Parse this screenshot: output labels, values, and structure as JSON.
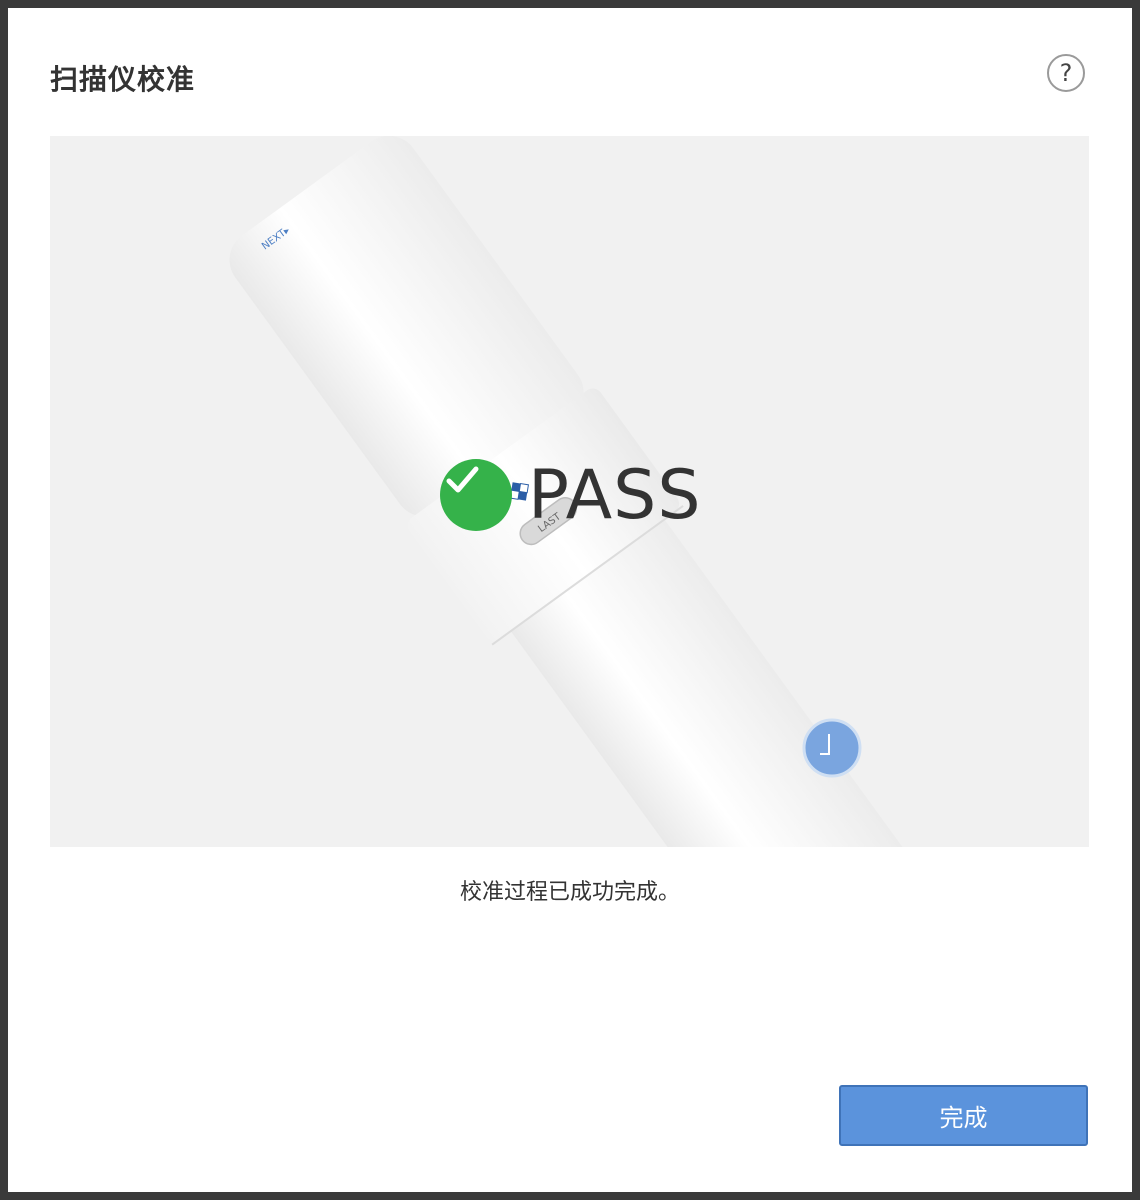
{
  "dialog": {
    "title": "扫描仪校准",
    "help_symbol": "?"
  },
  "illustration": {
    "button_next_label": "NEXT▸",
    "button_last_label": "LAST",
    "result_text": "PASS"
  },
  "status_message": "校准过程已成功完成。",
  "footer": {
    "done_label": "完成"
  },
  "colors": {
    "success_green": "#35b24a",
    "primary_button": "#5b93dc",
    "panel_bg": "#f1f1f1"
  }
}
